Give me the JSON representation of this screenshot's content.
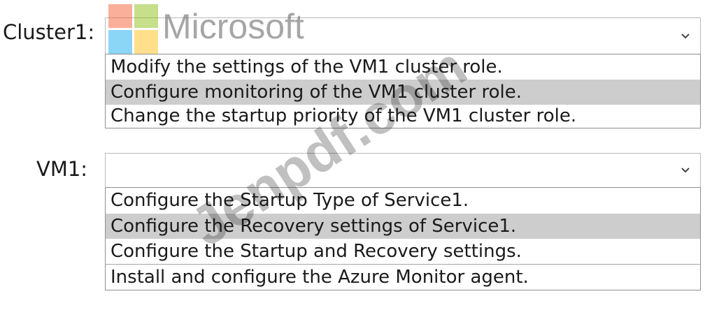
{
  "logo": {
    "text": "Microsoft",
    "colors": [
      "#f25022",
      "#7fba00",
      "#00a4ef",
      "#ffb900"
    ]
  },
  "watermark": {
    "text": "Jenpdf.com"
  },
  "groups": [
    {
      "label": "Cluster1:",
      "selected_value": "",
      "options": [
        "Modify the settings of the VM1 cluster role.",
        "Configure monitoring of the VM1 cluster role.",
        "Change the startup priority of the VM1 cluster role."
      ],
      "highlighted_index": 1
    },
    {
      "label": "VM1:",
      "selected_value": "",
      "options": [
        "Configure the Startup Type of Service1.",
        "Configure the Recovery settings of Service1.",
        "Configure the Startup and Recovery settings.",
        "Install and configure the Azure Monitor agent."
      ],
      "highlighted_index": 1
    }
  ],
  "colors": {
    "highlight": "#cdcdcd",
    "text": "#1a1a1a",
    "border": "#b9b9b9"
  }
}
